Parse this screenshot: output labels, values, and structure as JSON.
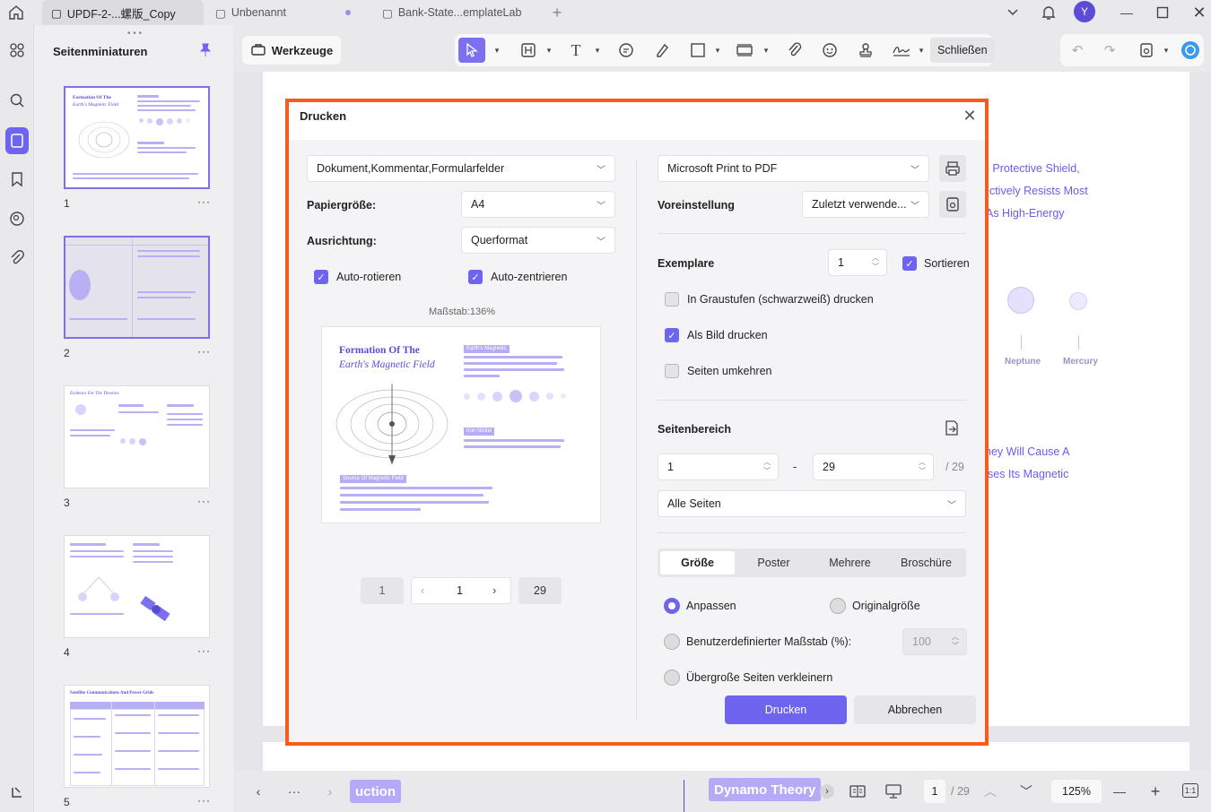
{
  "tabs": [
    {
      "label": "UPDF-2-...螺版_Copy"
    },
    {
      "label": "Unbenannt"
    },
    {
      "label": "Bank-State...emplateLab"
    }
  ],
  "user": {
    "avatar_letter": "Y"
  },
  "sidebar": {
    "title": "Seitenminiaturen",
    "thumbnails": [
      {
        "number": "1",
        "more": "···",
        "title1": "Formation Of The",
        "title2": "Earth's Magnetic Field"
      },
      {
        "number": "2",
        "more": "···"
      },
      {
        "number": "3",
        "more": "···",
        "title1": "Evidence For The Theories"
      },
      {
        "number": "4",
        "more": "···"
      },
      {
        "number": "5",
        "more": "···",
        "title1": "Satellite Communications And Power Grids"
      }
    ]
  },
  "toolbar": {
    "tools_label": "Werkzeuge",
    "close_label": "Schließen"
  },
  "background": {
    "lines": [
      "e Protective Shield,",
      "ectively Resists Most",
      "As High-Energy",
      "hey Will Cause A",
      "ses Its Magnetic"
    ],
    "planet_labels": [
      "Neptune",
      "Mercury"
    ]
  },
  "bottom": {
    "chip_left": "uction",
    "chip_right": "Dynamo Theory",
    "more": "···",
    "page_current": "1",
    "page_total": "/ 29",
    "zoom": "125%"
  },
  "dialog": {
    "title": "Drucken",
    "content_select": "Dokument,Kommentar,Formularfelder",
    "paper_label": "Papiergröße:",
    "paper_value": "A4",
    "orientation_label": "Ausrichtung:",
    "orientation_value": "Querformat",
    "auto_rotate": "Auto-rotieren",
    "auto_center": "Auto-zentrieren",
    "scale": "Maßstab:136%",
    "preview": {
      "title1": "Formation Of The",
      "title2": "Earth's Magnetic Field",
      "tag1": "Earth's Magnetic",
      "tag2": "Iron Nickel",
      "tag3": "Source Of Magnetic Field"
    },
    "pager": {
      "first": "1",
      "current": "1",
      "last": "29"
    },
    "printer": "Microsoft Print to PDF",
    "preset_label": "Voreinstellung",
    "preset_value": "Zuletzt verwende...",
    "copies_label": "Exemplare",
    "copies_value": "1",
    "collate": "Sortieren",
    "grayscale": "In Graustufen (schwarzweiß) drucken",
    "as_image": "Als Bild drucken",
    "reverse": "Seiten umkehren",
    "range_label": "Seitenbereich",
    "range_from": "1",
    "range_dash": "-",
    "range_to": "29",
    "range_total": "/ 29",
    "range_select": "Alle Seiten",
    "segments": [
      "Größe",
      "Poster",
      "Mehrere",
      "Broschüre"
    ],
    "fit": "Anpassen",
    "original": "Originalgröße",
    "custom_scale": "Benutzerdefinierter Maßstab (%):",
    "custom_value": "100",
    "shrink": "Übergroße Seiten verkleinern",
    "print_button": "Drucken",
    "cancel_button": "Abbrechen"
  }
}
